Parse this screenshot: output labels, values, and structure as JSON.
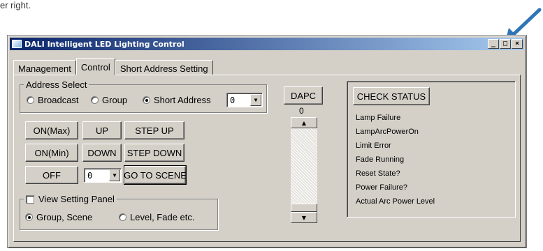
{
  "caption": "er right.",
  "window": {
    "title": "DALI Intelligent LED Lighting Control",
    "minimize": "_",
    "maximize": "□",
    "close": "×"
  },
  "tabs": [
    "Management",
    "Control",
    "Short Address Setting"
  ],
  "address_select": {
    "legend": "Address Select",
    "options": [
      "Broadcast",
      "Group",
      "Short Address"
    ],
    "selected": "Short Address",
    "short_address_value": "0"
  },
  "buttons": {
    "on_max": "ON(Max)",
    "up": "UP",
    "step_up": "STEP UP",
    "on_min": "ON(Min)",
    "down": "DOWN",
    "step_down": "STEP DOWN",
    "off": "OFF",
    "go_to_scene": "GO TO SCENE",
    "scene_value": "0"
  },
  "view_setting": {
    "label": "View Setting Panel",
    "checked": false,
    "options": [
      "Group, Scene",
      "Level, Fade etc."
    ],
    "selected": "Group, Scene"
  },
  "dapc": {
    "label": "DAPC",
    "value": "0"
  },
  "status": {
    "button": "CHECK STATUS",
    "items": [
      "Lamp Failure",
      "LampArcPowerOn",
      "Limit Error",
      "Fade Running",
      "Reset State?",
      "Power Failure?",
      "Actual Arc Power Level"
    ]
  },
  "colors": {
    "arrow": "#2e75b6",
    "title_bar_start": "#0a246a",
    "title_bar_end": "#a6caf0",
    "face": "#d4d0c8"
  },
  "icons": {
    "arrow": "arrow-icon",
    "app": "app-icon",
    "scroll_up": "arrow-up-icon",
    "scroll_down": "arrow-down-icon",
    "dropdown": "chevron-down-icon"
  }
}
